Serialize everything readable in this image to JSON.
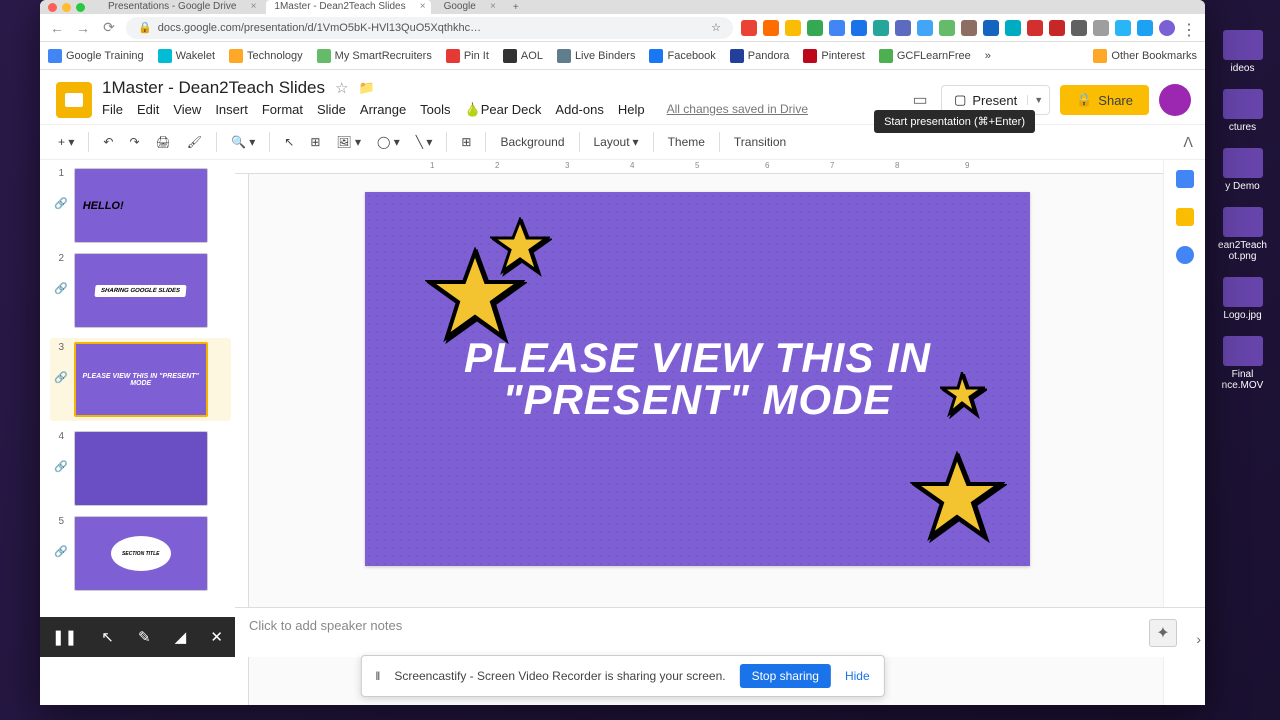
{
  "browser": {
    "tabs": [
      {
        "title": "Presentations - Google Drive"
      },
      {
        "title": "1Master - Dean2Teach Slides"
      },
      {
        "title": "Google"
      }
    ],
    "url": "docs.google.com/presentation/d/1VmO5bK-HVl13QuO5Xqthkhc…"
  },
  "bookmarks": [
    "Google Training",
    "Wakelet",
    "Technology",
    "My SmartRecruiters",
    "Pin It",
    "AOL",
    "Live Binders",
    "Facebook",
    "Pandora",
    "Pinterest",
    "GCFLearnFree"
  ],
  "other_bookmarks": "Other Bookmarks",
  "app": {
    "title": "1Master - Dean2Teach Slides",
    "menus": [
      "File",
      "Edit",
      "View",
      "Insert",
      "Format",
      "Slide",
      "Arrange",
      "Tools"
    ],
    "pear_deck": "Pear Deck",
    "addons": "Add-ons",
    "help": "Help",
    "changes": "All changes saved in Drive",
    "present": "Present",
    "share": "Share",
    "tooltip": "Start presentation (⌘+Enter)"
  },
  "toolbar": {
    "background": "Background",
    "layout": "Layout",
    "theme": "Theme",
    "transition": "Transition"
  },
  "slides": [
    {
      "n": "1",
      "text": "HELLO!"
    },
    {
      "n": "2",
      "text": "SHARING GOOGLE SLIDES"
    },
    {
      "n": "3",
      "text": "PLEASE VIEW THIS IN \"PRESENT\" MODE"
    },
    {
      "n": "4",
      "text": ""
    },
    {
      "n": "5",
      "text": "SECTION TITLE"
    }
  ],
  "canvas": {
    "line1": "PLEASE VIEW THIS IN",
    "line2": "\"PRESENT\" MODE"
  },
  "speaker_notes": "Click to add speaker notes",
  "share_bar": {
    "msg": "Screencastify - Screen Video Recorder is sharing your screen.",
    "stop": "Stop sharing",
    "hide": "Hide"
  },
  "desktop": [
    "ideos",
    "ctures",
    "y Demo",
    "ean2Teach ot.png",
    "Logo.jpg",
    "Final nce.MOV"
  ]
}
